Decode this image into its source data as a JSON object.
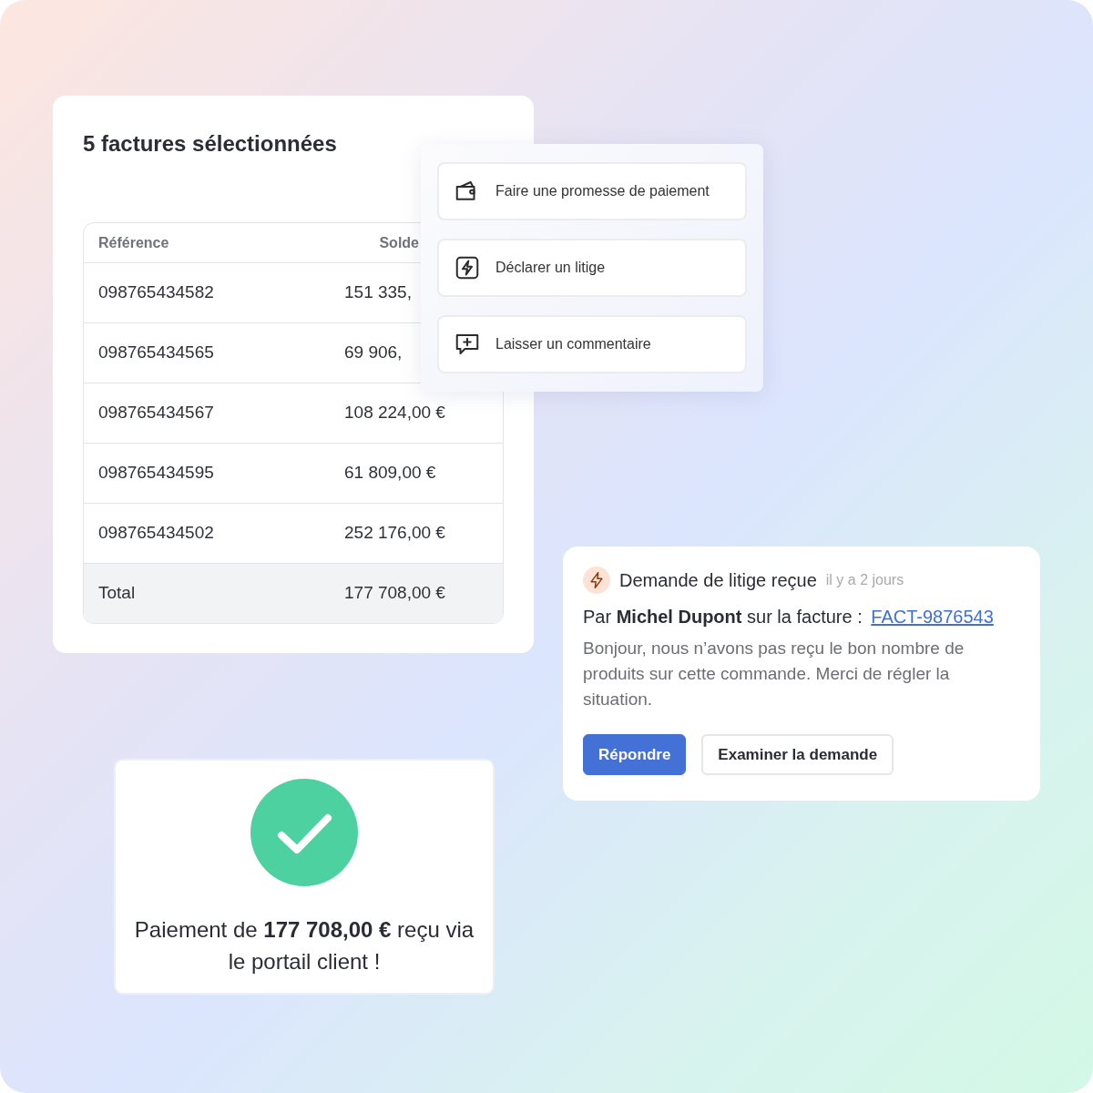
{
  "selection_card": {
    "title": "5 factures sélectionnées",
    "table": {
      "columns": [
        "Référence",
        "Solde"
      ],
      "rows": [
        {
          "reference": "098765434582",
          "balance": "151 335,"
        },
        {
          "reference": "098765434565",
          "balance": "69 906,"
        },
        {
          "reference": "098765434567",
          "balance": "108 224,00 €"
        },
        {
          "reference": "098765434595",
          "balance": "61 809,00 €"
        },
        {
          "reference": "098765434502",
          "balance": "252 176,00 €"
        }
      ],
      "total": {
        "label": "Total",
        "value": "177 708,00 €"
      }
    }
  },
  "action_menu": {
    "items": [
      {
        "kind": "wallet",
        "label": "Faire une promesse de paiement"
      },
      {
        "kind": "bolt",
        "label": "Déclarer un litige"
      },
      {
        "kind": "comment",
        "label": "Laisser un commentaire"
      }
    ]
  },
  "dispute_notification": {
    "title": "Demande de litige reçue",
    "time": "il y a 2 jours",
    "byline": "Par **Michel Dupont** sur la facture :",
    "invoice_link": "FACT-9876543",
    "message": "Bonjour, nous n’avons pas reçu le bon nombre de produits sur cette commande. Merci de régler la situation.",
    "buttons": [
      {
        "kind": "primary",
        "label": "Répondre"
      },
      {
        "kind": "secondary",
        "label": "Examiner la demande"
      }
    ]
  },
  "payment_card": {
    "message": "Paiement de **177 708,00 €** reçu via le portail client !"
  }
}
